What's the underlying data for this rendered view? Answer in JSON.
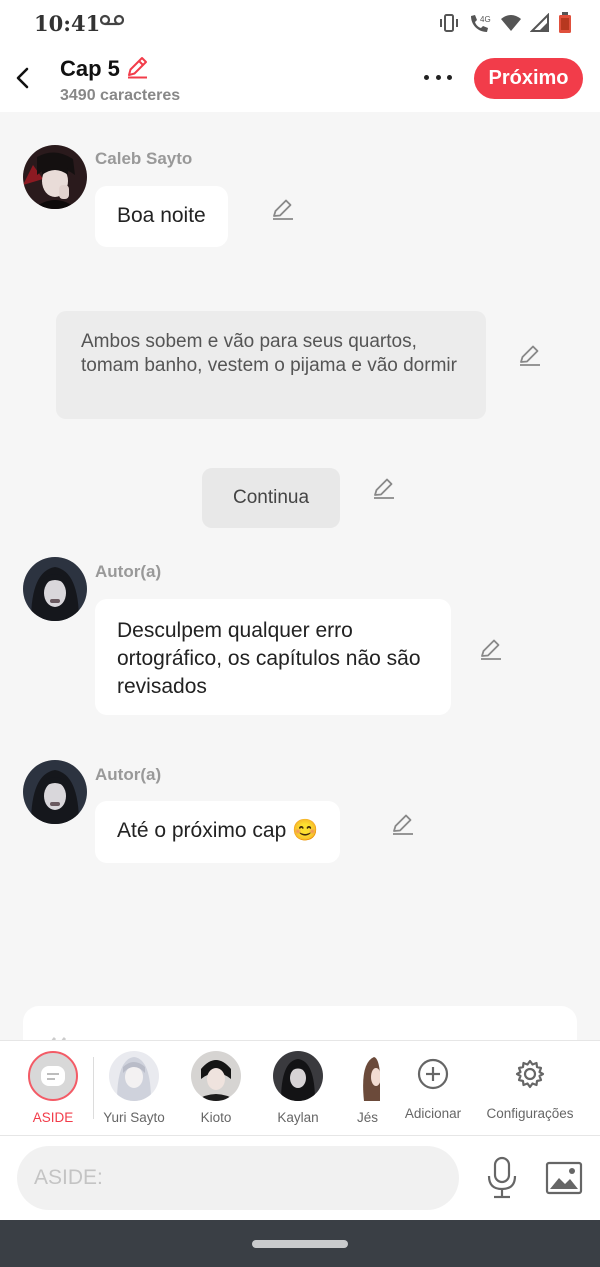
{
  "status_bar": {
    "time": "10:41",
    "network": "4G"
  },
  "header": {
    "title": "Cap 5",
    "subtitle": "3490 caracteres",
    "next_label": "Próximo"
  },
  "chat": {
    "messages": [
      {
        "speaker": "Caleb Sayto",
        "text": "Boa noite"
      },
      {
        "narration": "Ambos sobem e vão para seus quartos, tomam banho, vestem o pijama e vão dormir"
      },
      {
        "continue_label": "Continua"
      },
      {
        "speaker": "Autor(a)",
        "text": "Desculpem qualquer erro ortográfico, os capítulos não são revisados"
      },
      {
        "speaker": "Autor(a)",
        "text": "Até o próximo cap 😊"
      }
    ]
  },
  "character_bar": {
    "items": [
      {
        "label": "ASIDE",
        "selected": true
      },
      {
        "label": "Yuri Sayto"
      },
      {
        "label": "Kioto"
      },
      {
        "label": "Kaylan"
      },
      {
        "label": "Jés"
      },
      {
        "label": "Adicionar"
      },
      {
        "label": "Configurações"
      }
    ]
  },
  "composer": {
    "placeholder": "ASIDE:"
  },
  "colors": {
    "accent": "#f23c4a",
    "background": "#f6f6f6",
    "bubble": "#ffffff",
    "narration": "#ececec"
  },
  "icons": [
    "voicemail-icon",
    "vibrate-icon",
    "wifi-calling-icon",
    "wifi-icon",
    "signal-icon",
    "battery-icon",
    "back-icon",
    "pencil-icon",
    "more-icon",
    "chat-bubble-icon",
    "plus-circle-icon",
    "gear-icon",
    "microphone-icon",
    "image-icon"
  ]
}
